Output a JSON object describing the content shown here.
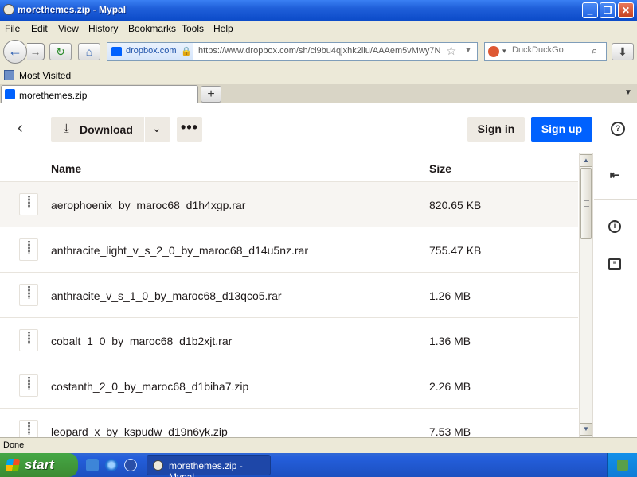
{
  "window": {
    "title": "morethemes.zip - Mypal",
    "controls": [
      "minimize",
      "maximize",
      "close"
    ]
  },
  "menu": [
    "File",
    "Edit",
    "View",
    "History",
    "Bookmarks",
    "Tools",
    "Help"
  ],
  "nav": {
    "site_identity": "dropbox.com",
    "url": "https://www.dropbox.com/sh/cl9bu4qjxhk2liu/AAAem5vMwy7N",
    "search_placeholder": "DuckDuckGo"
  },
  "bookmarks": {
    "most_visited": "Most Visited"
  },
  "tabs": [
    {
      "label": "morethemes.zip"
    }
  ],
  "page": {
    "download_label": "Download",
    "more_label": "•••",
    "signin_label": "Sign in",
    "signup_label": "Sign up",
    "help_icon": "?",
    "columns": {
      "name": "Name",
      "size": "Size"
    },
    "files": [
      {
        "name": "aerophoenix_by_maroc68_d1h4xgp.rar",
        "size": "820.65 KB"
      },
      {
        "name": "anthracite_light_v_s_2_0_by_maroc68_d14u5nz.rar",
        "size": "755.47 KB"
      },
      {
        "name": "anthracite_v_s_1_0_by_maroc68_d13qco5.rar",
        "size": "1.26 MB"
      },
      {
        "name": "cobalt_1_0_by_maroc68_d1b2xjt.rar",
        "size": "1.36 MB"
      },
      {
        "name": "costanth_2_0_by_maroc68_d1biha7.zip",
        "size": "2.26 MB"
      },
      {
        "name": "leopard_x_by_kspudw_d19n6yk.zip",
        "size": "7.53 MB"
      }
    ]
  },
  "status": "Done",
  "taskbar": {
    "start_label": "start",
    "task_label": "morethemes.zip - Mypal"
  }
}
